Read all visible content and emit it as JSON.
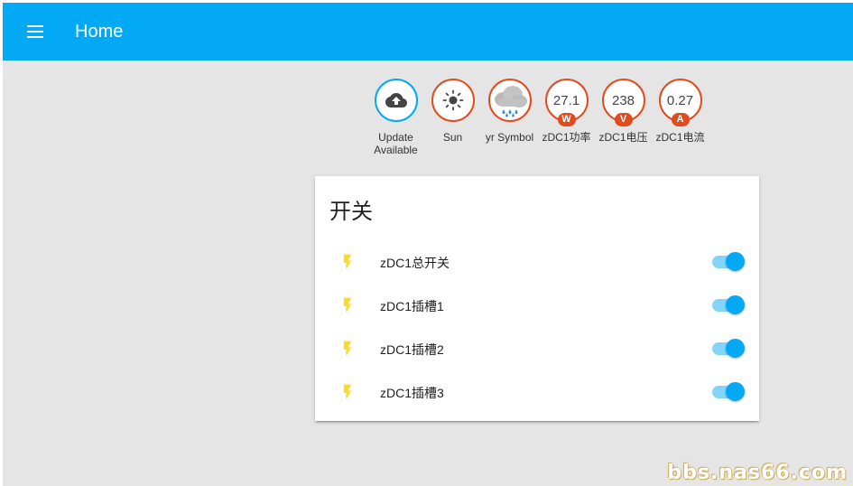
{
  "toolbar": {
    "title": "Home",
    "menu_icon": "menu-icon",
    "color": "#03a9f4"
  },
  "badges": [
    {
      "icon": "cloud-upload-icon",
      "value": "",
      "unit": "",
      "label": "Update Available",
      "border": "#03a9f4"
    },
    {
      "icon": "sun-icon",
      "value": "",
      "unit": "",
      "label": "Sun",
      "border": "#df4c1e"
    },
    {
      "icon": "rain-cloud-icon",
      "value": "",
      "unit": "",
      "label": "yr Symbol",
      "border": "#df4c1e"
    },
    {
      "icon": "",
      "value": "27.1",
      "unit": "W",
      "label": "zDC1功率",
      "border": "#df4c1e"
    },
    {
      "icon": "",
      "value": "238",
      "unit": "V",
      "label": "zDC1电压",
      "border": "#df4c1e"
    },
    {
      "icon": "",
      "value": "0.27",
      "unit": "A",
      "label": "zDC1电流",
      "border": "#df4c1e"
    }
  ],
  "card": {
    "title": "开关",
    "rows": [
      {
        "icon": "flash-icon",
        "label": "zDC1总开关",
        "on": true
      },
      {
        "icon": "flash-icon",
        "label": "zDC1插槽1",
        "on": true
      },
      {
        "icon": "flash-icon",
        "label": "zDC1插槽2",
        "on": true
      },
      {
        "icon": "flash-icon",
        "label": "zDC1插槽3",
        "on": true
      }
    ]
  },
  "watermark": "bbs.nas66.com",
  "colors": {
    "accent": "#03a9f4",
    "badge_border": "#df4c1e",
    "icon_yellow": "#fdd835",
    "background": "#e5e5e5"
  }
}
